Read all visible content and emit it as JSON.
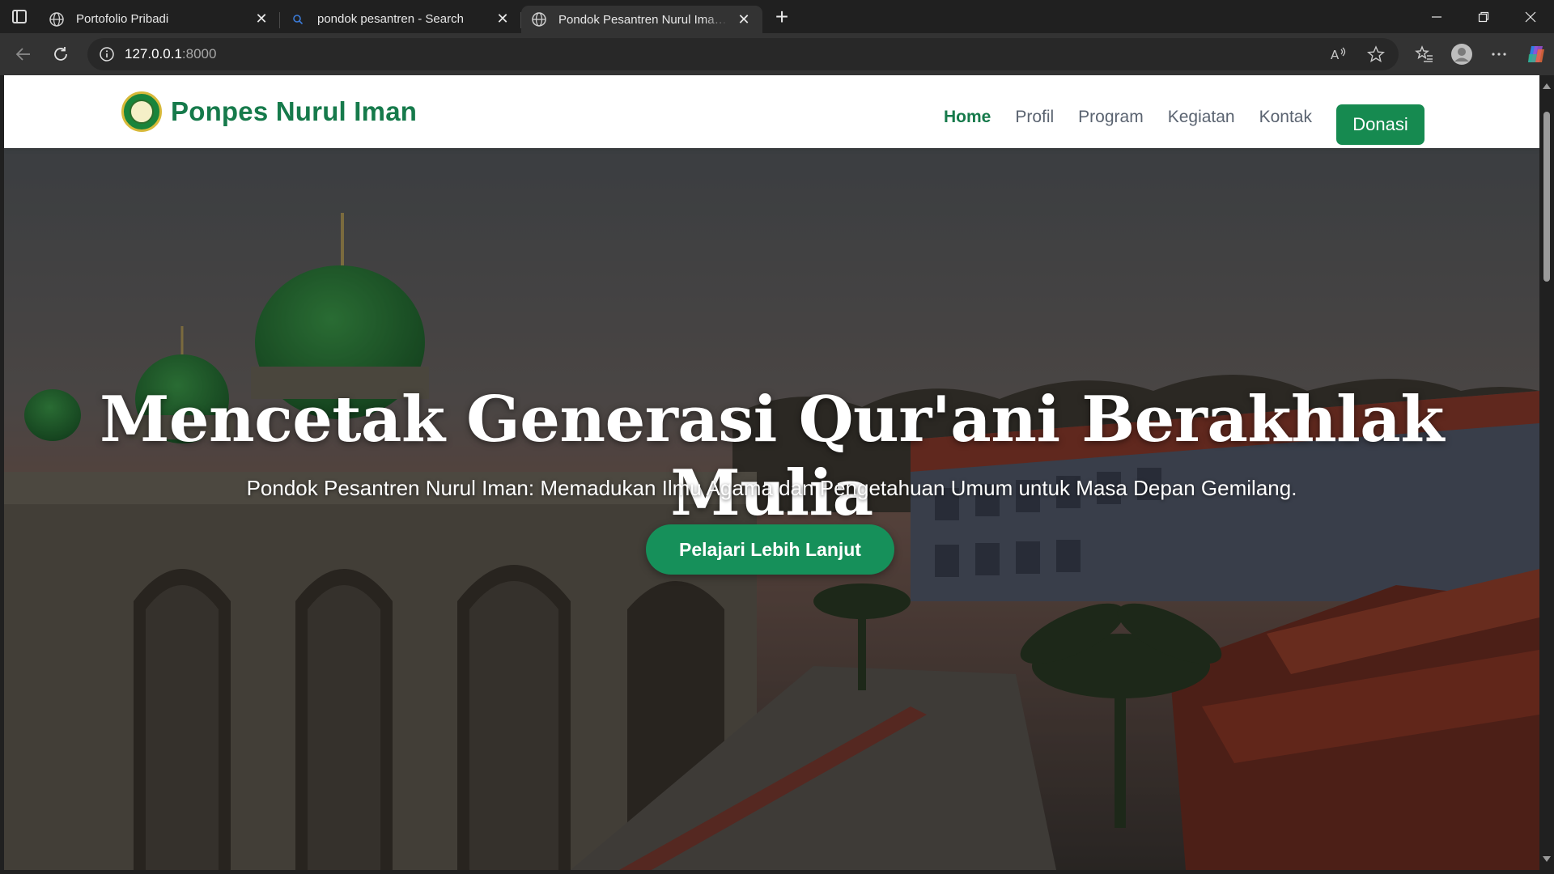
{
  "browser": {
    "tabs": [
      {
        "title": "Portofolio Pribadi",
        "icon": "globe-icon",
        "active": false
      },
      {
        "title": "pondok pesantren - Search",
        "icon": "search-icon",
        "active": false
      },
      {
        "title": "Pondok Pesantren Nurul Iman - B",
        "icon": "globe-icon",
        "active": true
      }
    ],
    "address": {
      "host": "127.0.0.1",
      "port": ":8000"
    }
  },
  "site": {
    "brand": "Ponpes Nurul Iman",
    "nav": [
      {
        "label": "Home",
        "active": true
      },
      {
        "label": "Profil",
        "active": false
      },
      {
        "label": "Program",
        "active": false
      },
      {
        "label": "Kegiatan",
        "active": false
      },
      {
        "label": "Kontak",
        "active": false
      }
    ],
    "donate_label": "Donasi",
    "accent_color": "#168a50",
    "hero": {
      "title": "Mencetak Generasi Qur'ani Berakhlak Mulia",
      "subtitle": "Pondok Pesantren Nurul Iman: Memadukan Ilmu Agama dan Pengetahuan Umum untuk Masa Depan Gemilang.",
      "cta_label": "Pelajari Lebih Lanjut"
    }
  }
}
